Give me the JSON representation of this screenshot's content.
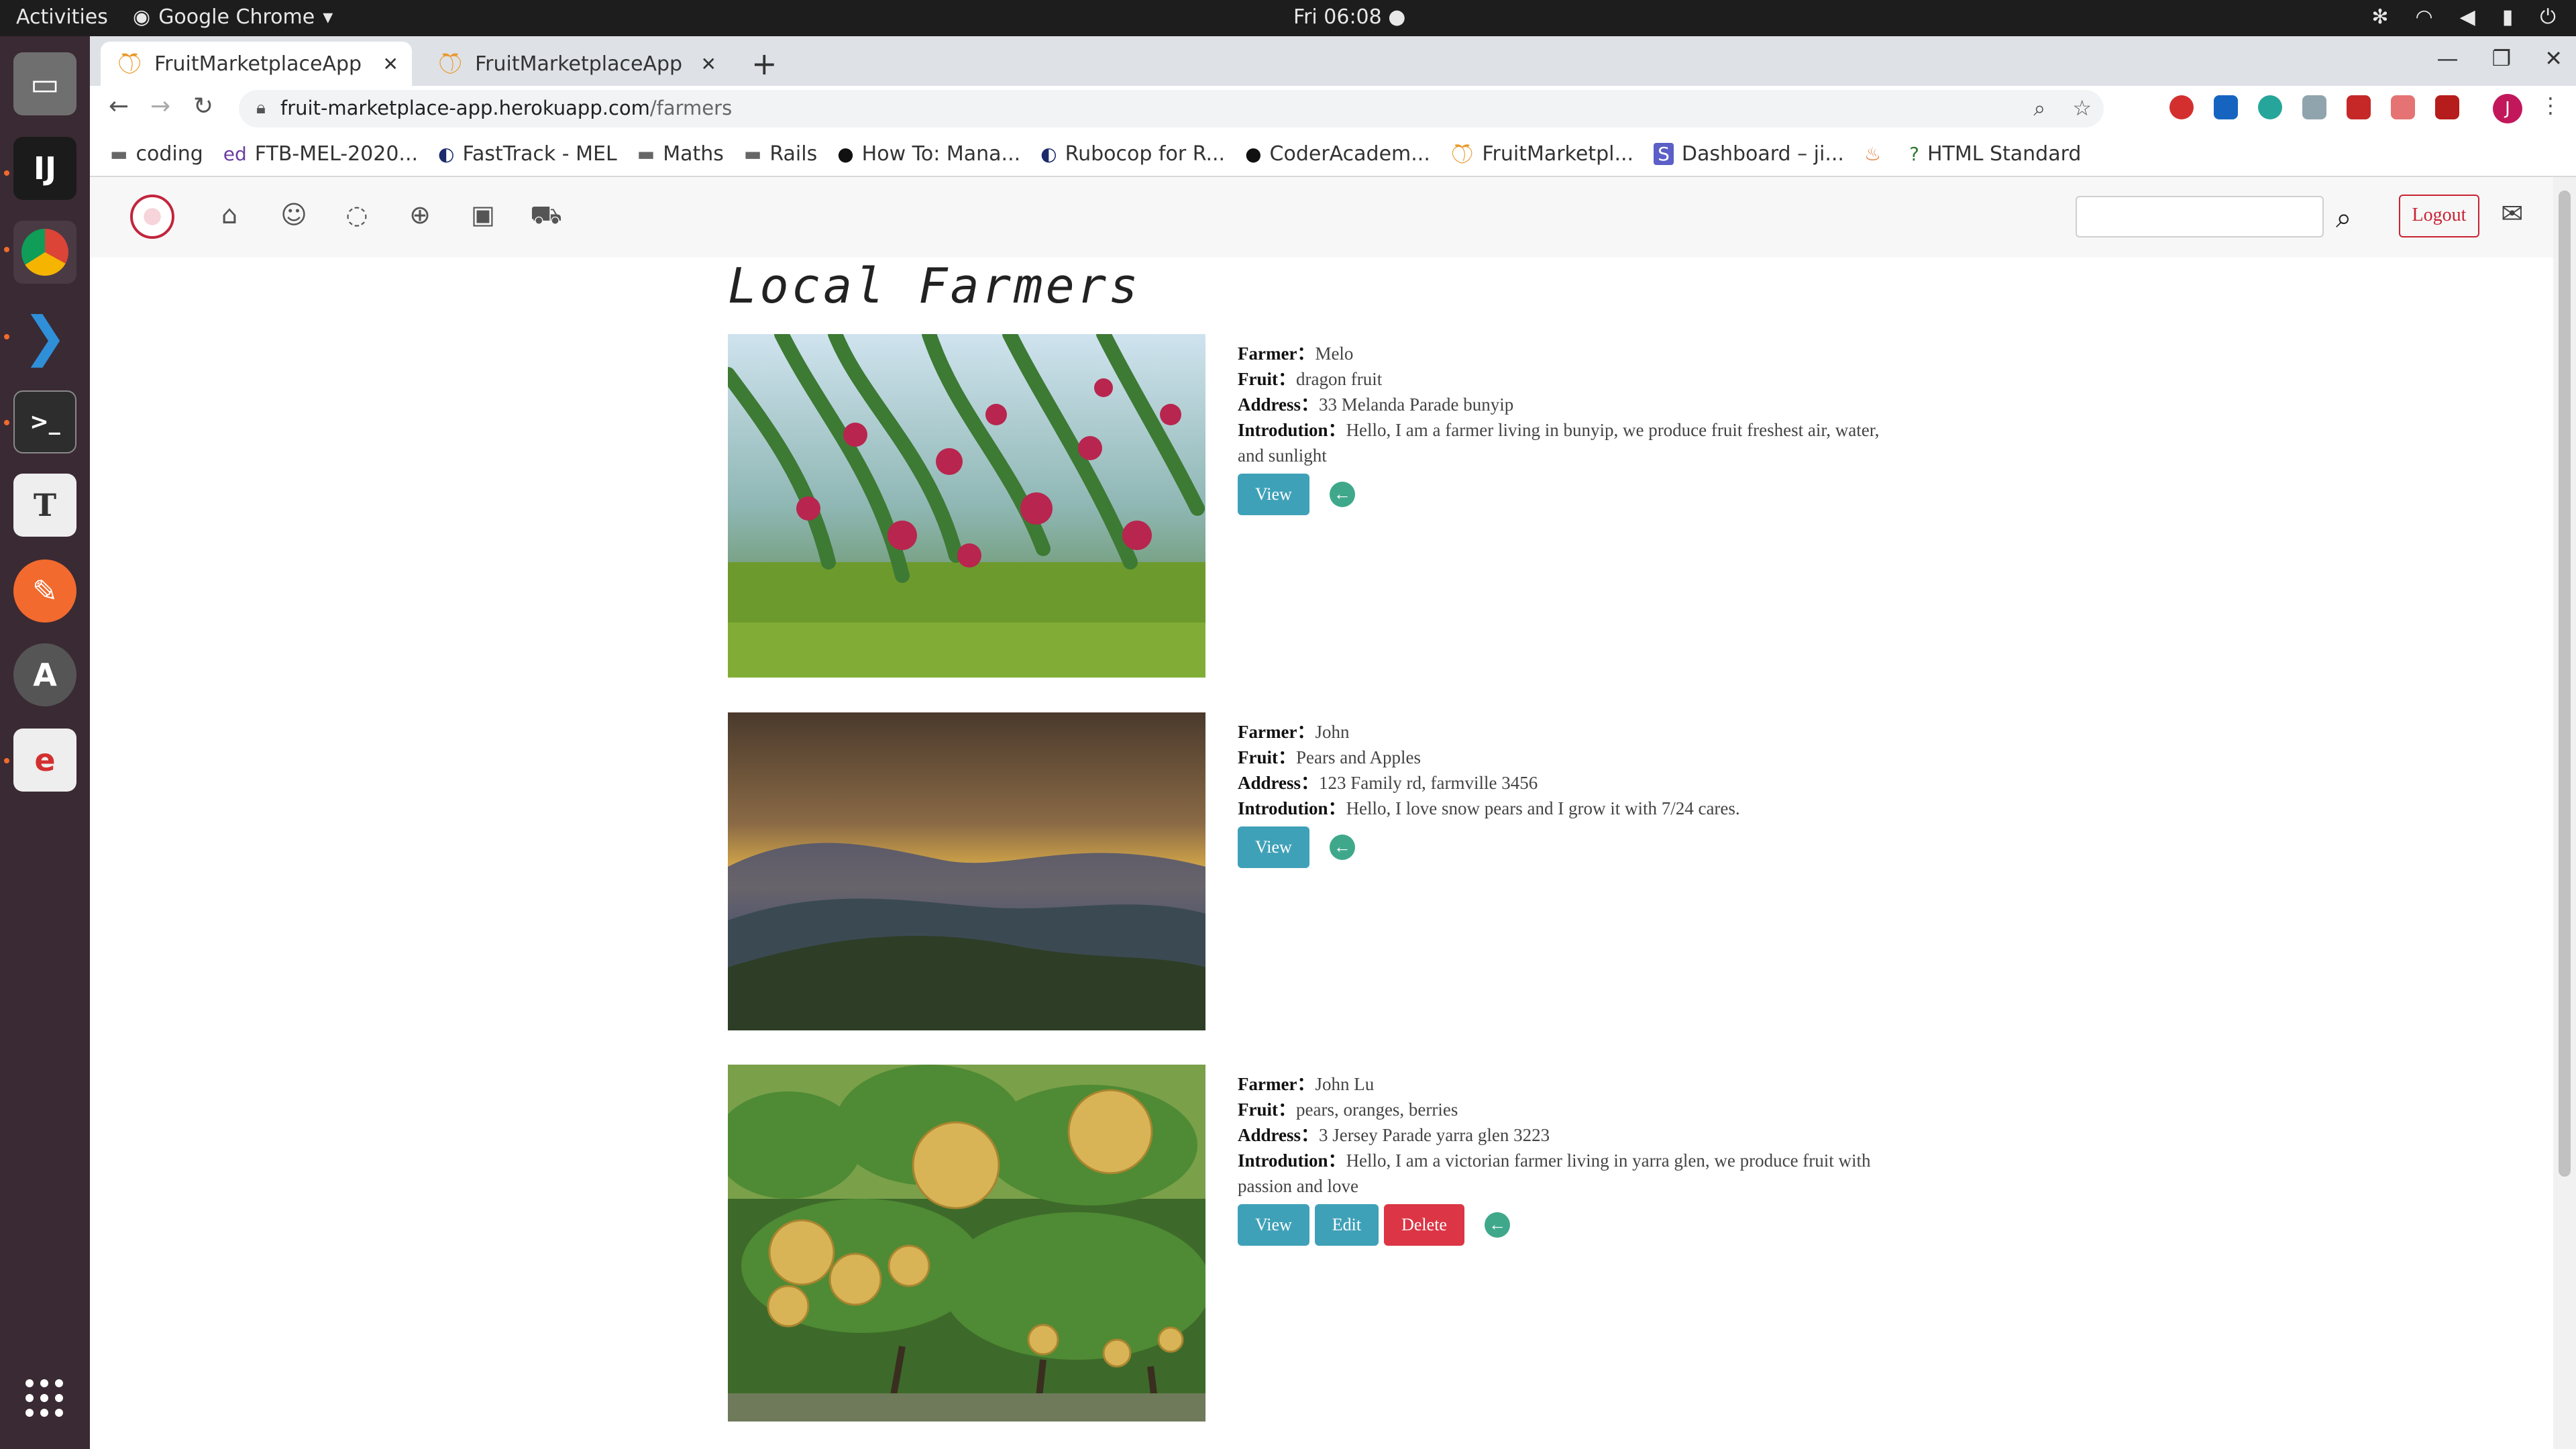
{
  "os": {
    "activities": "Activities",
    "app_name": "Google Chrome",
    "clock": "Fri 06:08"
  },
  "browser": {
    "tabs": [
      {
        "title": "FruitMarketplaceApp"
      },
      {
        "title": "FruitMarketplaceApp"
      }
    ],
    "url_domain": "fruit-marketplace-app.herokuapp.com",
    "url_path": "/farmers",
    "profile_initial": "J",
    "bookmarks": [
      {
        "label": "coding",
        "icon": "folder-icon"
      },
      {
        "label": "FTB-MEL-2020...",
        "icon": "ed-icon"
      },
      {
        "label": "FastTrack - MEL",
        "icon": "coder-academy-icon"
      },
      {
        "label": "Maths",
        "icon": "folder-icon"
      },
      {
        "label": "Rails",
        "icon": "folder-icon"
      },
      {
        "label": "How To: Mana...",
        "icon": "github-icon"
      },
      {
        "label": "Rubocop for R...",
        "icon": "coder-academy-icon"
      },
      {
        "label": "CoderAcadem...",
        "icon": "github-icon"
      },
      {
        "label": "FruitMarketpl...",
        "icon": "fruit-icon"
      },
      {
        "label": "Dashboard – ji...",
        "icon": "s-icon"
      },
      {
        "label": "",
        "icon": "flame-icon"
      },
      {
        "label": "HTML Standard",
        "icon": "help-icon"
      }
    ]
  },
  "app": {
    "logout_label": "Logout",
    "search_placeholder": "",
    "page_title": "Local Farmers",
    "labels": {
      "farmer": "Farmer：",
      "fruit": "Fruit：",
      "address": "Address：",
      "introduction": "Introdution："
    },
    "buttons": {
      "view": "View",
      "edit": "Edit",
      "delete": "Delete"
    },
    "farmers": [
      {
        "name": "Melo",
        "fruit": "dragon fruit",
        "address": "33 Melanda Parade bunyip",
        "introduction": "Hello, I am a farmer living in bunyip, we produce fruit freshest air, water, and sunlight",
        "image": "dragon-fruit-plants-photo"
      },
      {
        "name": "John",
        "fruit": "Pears and Apples",
        "address": "123 Family rd, farmville 3456",
        "introduction": "Hello, I love snow pears and I grow it with 7/24 cares.",
        "image": "mountain-sunset-photo"
      },
      {
        "name": "John Lu",
        "fruit": "pears, oranges, berries",
        "address": "3 Jersey Parade yarra glen 3223",
        "introduction": "Hello, I am a victorian farmer living in yarra glen, we produce fruit with passion and love",
        "image": "pear-orchard-photo"
      }
    ]
  }
}
